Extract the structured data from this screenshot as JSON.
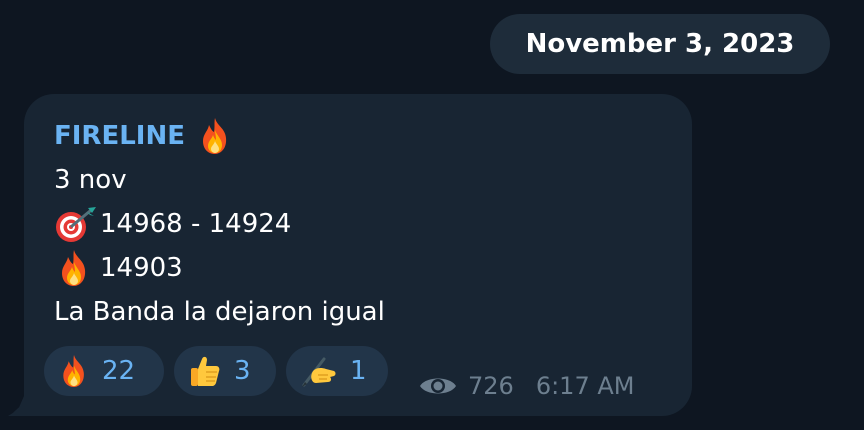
{
  "date_separator": "November 3, 2023",
  "message": {
    "sender": "FIRELINE",
    "sender_emoji": "fire-emoji",
    "lines": [
      {
        "icon": null,
        "text": "3 nov"
      },
      {
        "icon": "target-dart-emoji",
        "text": "14968 - 14924"
      },
      {
        "icon": "fire-emoji",
        "text": "14903"
      },
      {
        "icon": null,
        "text": "La Banda la dejaron igual"
      }
    ],
    "reactions": [
      {
        "icon": "fire-emoji",
        "count": "22"
      },
      {
        "icon": "thumbs-up-emoji",
        "count": "3"
      },
      {
        "icon": "writing-hand-emoji",
        "count": "1"
      }
    ],
    "views": "726",
    "time": "6:17 AM"
  },
  "colors": {
    "background": "#0e1621",
    "bubble": "#182533",
    "sender_name": "#6ab3f3",
    "reaction_bg": "#223549",
    "meta_text": "#6d7f8f"
  }
}
